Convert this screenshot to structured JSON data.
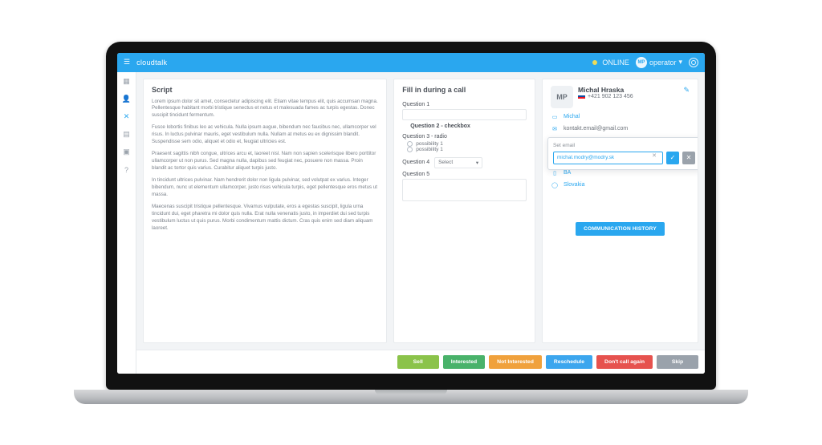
{
  "brand": "cloudtalk",
  "topbar": {
    "status": "ONLINE",
    "user_initials": "MP",
    "user_menu": "operator"
  },
  "sidebar": {
    "items": [
      {
        "name": "dashboard-icon"
      },
      {
        "name": "user-icon"
      },
      {
        "name": "campaign-icon",
        "active": true
      },
      {
        "name": "list-icon"
      },
      {
        "name": "calendar-icon"
      },
      {
        "name": "help-icon"
      }
    ]
  },
  "script_panel": {
    "title": "Script",
    "paragraphs": [
      "Lorem ipsum dolor sit amet, consectetur adipiscing elit. Etiam vitae tempus elit, quis accumsan magna. Pellentesque habitant morbi tristique senectus et netus et malesuada fames ac turpis egestas. Donec suscipit tincidunt fermentum.",
      "Fusce lobortis finibus leo ac vehicula. Nulla ipsum augue, bibendum nec faucibus nec, ullamcorper vel risus. In luctus pulvinar mauris, eget vestibulum nulla. Nullam at metus eu ex dignissim blandit. Suspendisse sem odio, aliquet et odio et, feugiat ultricies est.",
      "Praesent sagittis nibh congue, ultrices arcu et, laoreet nisl. Nam non sapien scelerisque libero porttitor ullamcorper ut non purus. Sed magna nulla, dapibus sed feugiat nec, posuere non massa. Proin blandit ac tortor quis varius. Curabitur aliquet turpis justo.",
      "In tincidunt ultrices pulvinar. Nam hendrerit dolor non ligula pulvinar, sed volutpat ex varius. Integer bibendum, nunc ut elementum ullamcorper, justo risus vehicula turpis, eget pellentesque eros metus ut massa.",
      "Maecenas suscipit tristique pellentesque. Vivamus vulputate, eros a egestas suscipit, ligula urna tincidunt dui, eget pharetra mi dolor quis nulla. Erat nulla venenatis justo, in imperdiet dui sed turpis vestibulum luctus ut quis purus. Morbi condimentum mattis dictum. Cras quis enim sed diam aliquam laoreet."
    ]
  },
  "fill_panel": {
    "title": "Fill in during a call",
    "q1": "Question 1",
    "q2": "Question 2 - checkbox",
    "q3": "Question 3 - radio",
    "opt1": "possibility 1",
    "opt2": "possibility 1",
    "q4": "Question 4",
    "select_label": "Select",
    "q5": "Question 5"
  },
  "contact": {
    "initials": "MP",
    "name": "Michal Hraska",
    "phone": "+421 902 123 456",
    "fields": {
      "first_name": "Michal",
      "email": "kontakt.email@gmail.com",
      "city": "BA",
      "country": "Slovakia"
    },
    "popover": {
      "title": "Set email",
      "value": "michal.modry@modry.sk"
    },
    "history_btn": "COMMUNICATION HISTORY"
  },
  "footer": {
    "sell": "Sell",
    "interested": "Interested",
    "not_interested": "Not Interested",
    "reschedule": "Reschedule",
    "dont_call": "Don't call again",
    "skip": "Skip"
  }
}
